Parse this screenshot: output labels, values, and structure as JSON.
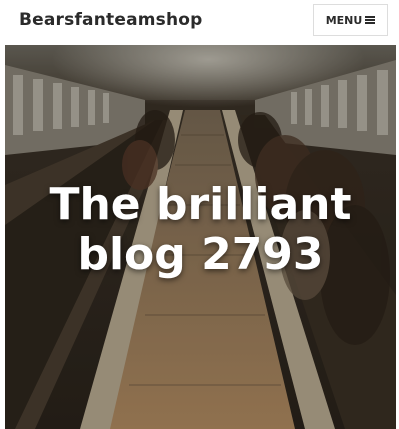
{
  "header": {
    "site_title": "Bearsfanteamshop",
    "menu_label": "MENU",
    "menu_icon": "hamburger-icon"
  },
  "hero": {
    "title_line1": "The brilliant",
    "title_line2": "blog 2793",
    "background_image": "escalator-photo"
  },
  "colors": {
    "title_text": "#2b2b2b",
    "hero_text": "#ffffff",
    "button_border": "#dddddd"
  }
}
